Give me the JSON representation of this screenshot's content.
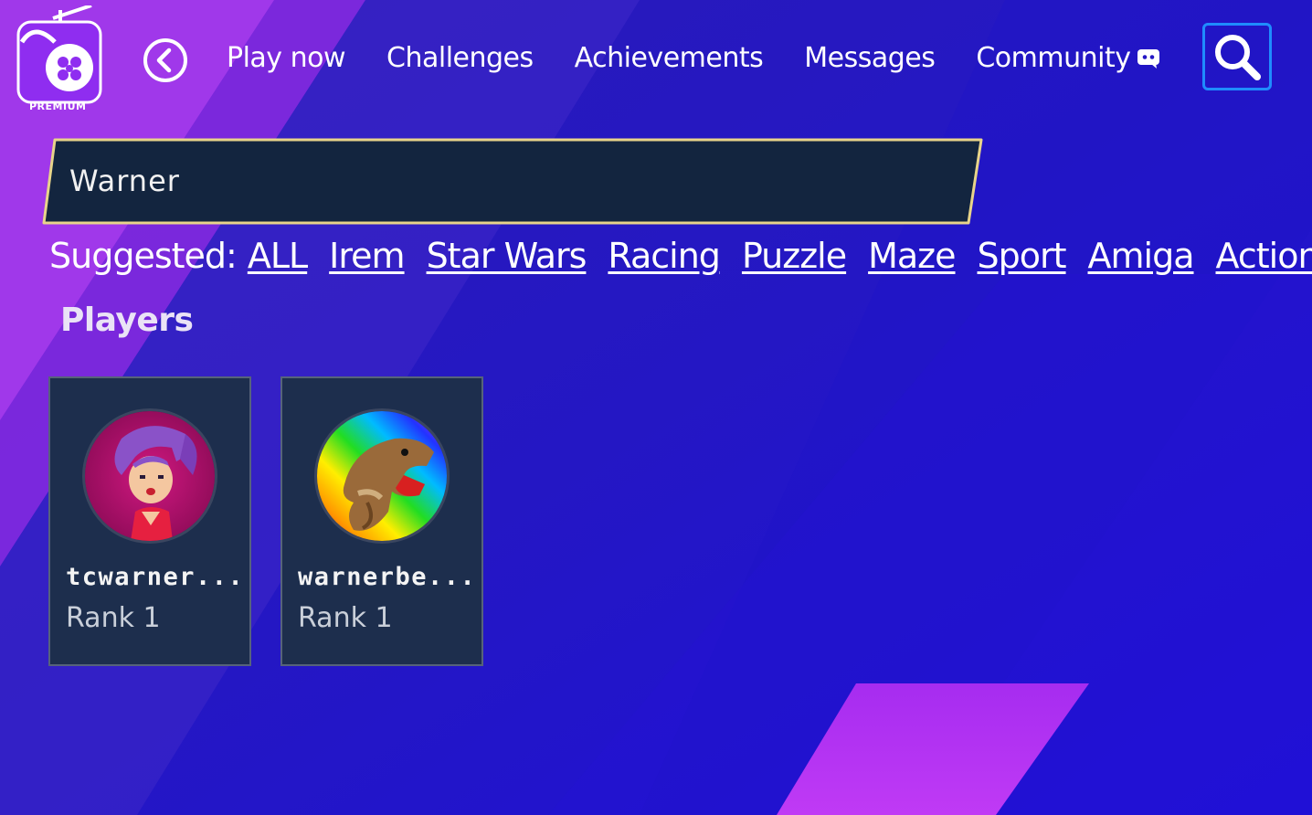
{
  "header": {
    "logo_badge": "PREMIUM",
    "nav": [
      {
        "label": "Play now"
      },
      {
        "label": "Challenges"
      },
      {
        "label": "Achievements"
      },
      {
        "label": "Messages"
      },
      {
        "label": "Community"
      }
    ],
    "icons": {
      "back": "back-circle-icon",
      "discord": "discord-icon",
      "search": "search-icon"
    }
  },
  "search": {
    "value": "Warner"
  },
  "suggested": {
    "label": "Suggested:",
    "links": [
      "ALL",
      "Irem",
      "Star Wars",
      "Racing",
      "Puzzle",
      "Maze",
      "Sport",
      "Amiga",
      "Action"
    ]
  },
  "players": {
    "title": "Players",
    "items": [
      {
        "name": "tcwarner...",
        "rank": "Rank 1"
      },
      {
        "name": "warnerbe...",
        "rank": "Rank 1"
      }
    ]
  },
  "colors": {
    "accent": "#1f8cff",
    "search_border": "#e8d48a",
    "card_bg": "#1d2e4d",
    "brand_purple": "#9b2cf5"
  }
}
